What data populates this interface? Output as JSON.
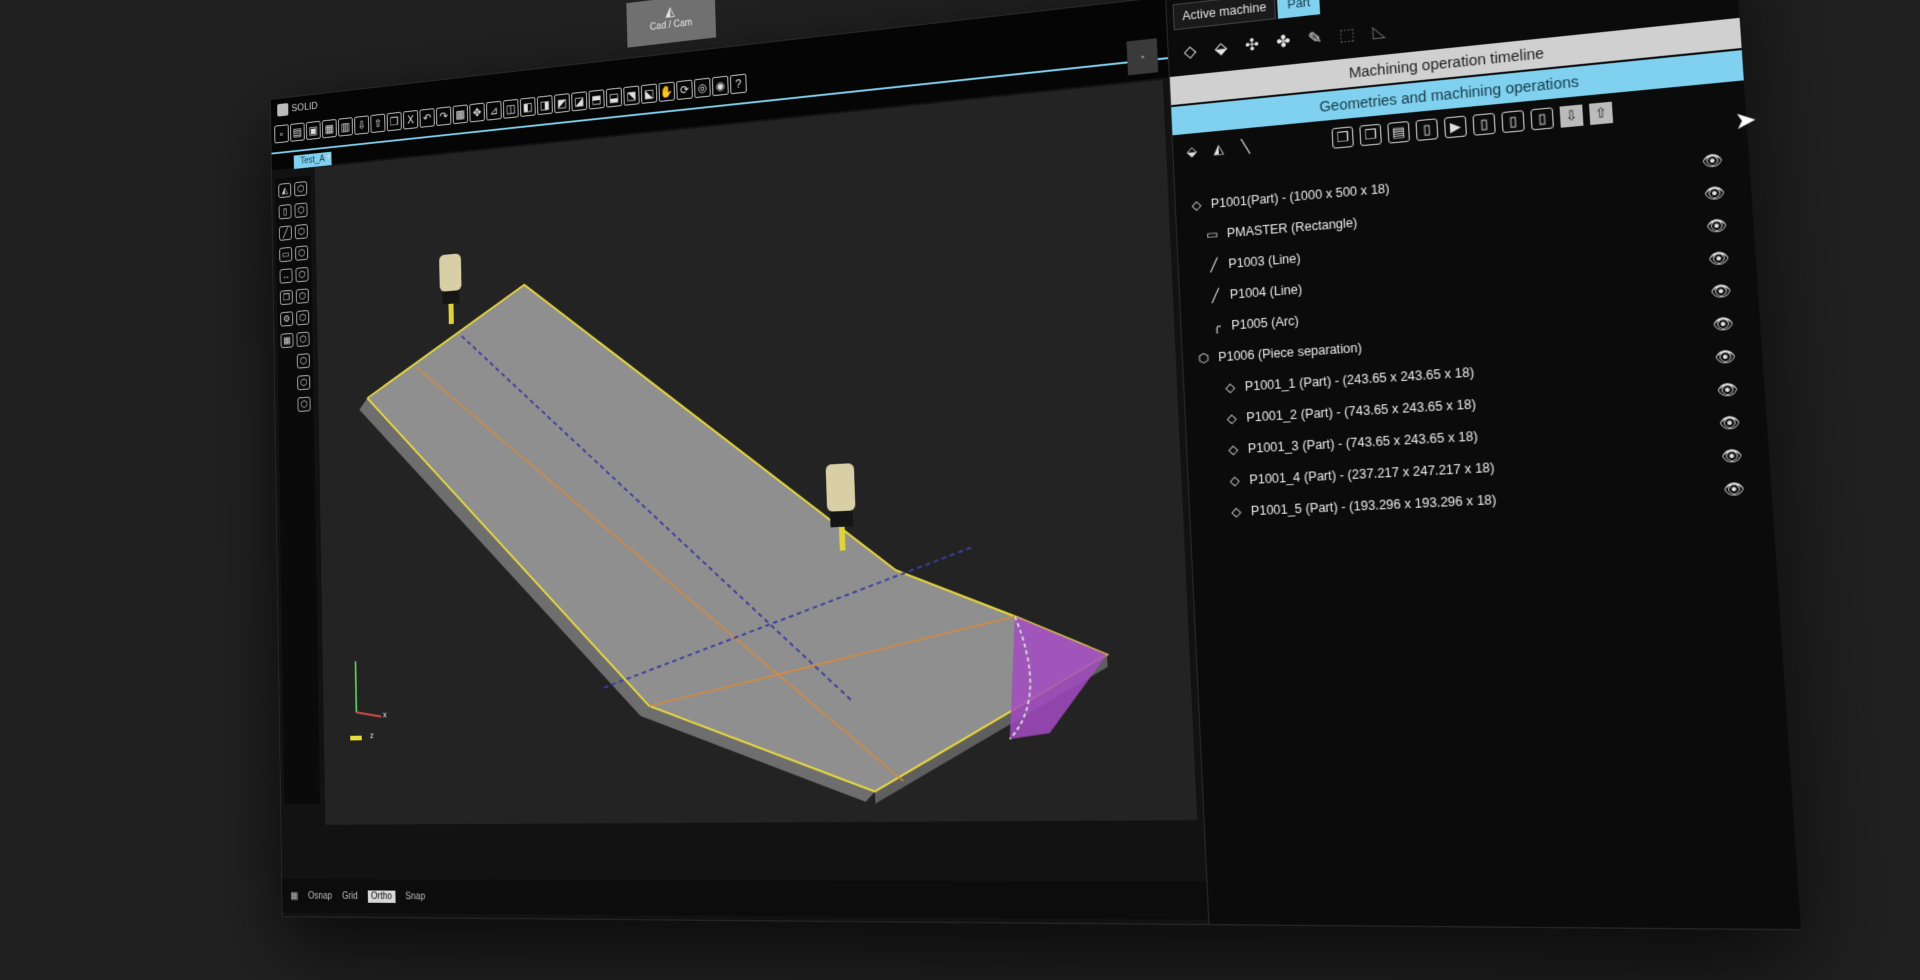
{
  "app": {
    "title": "SOLID",
    "mode_tab": "Cad / Cam"
  },
  "toolbar": {
    "icons": [
      "new-file-icon",
      "open-file-icon",
      "save-icon",
      "save-as-icon",
      "print-icon",
      "import-icon",
      "export-icon",
      "undo-icon",
      "redo-icon",
      "copy-icon",
      "delete-icon",
      "rotate-icon",
      "move-icon",
      "measure-icon",
      "lock-icon",
      "view-top-icon",
      "view-front-icon",
      "view-side-icon",
      "view-iso-icon",
      "view-back-icon",
      "view-bottom-icon",
      "view-left-icon",
      "view-right-icon",
      "wireframe-icon",
      "pan-icon",
      "orbit-icon",
      "zoom-fit-icon",
      "zoom-window-icon",
      "help-icon"
    ],
    "help_glyph": "?",
    "delete_glyph": "X"
  },
  "document_tab": {
    "label": "Test_A"
  },
  "status_bar": {
    "items": [
      "Osnap",
      "Grid",
      "Ortho",
      "Snap"
    ],
    "active": "Ortho"
  },
  "viewport": {
    "axis_label_z": "z",
    "axis_label_x": "x",
    "part_colors": {
      "top": "#8f8f8f",
      "side": "#6e6e6e",
      "outline": "#e9d93c",
      "dashed": "#3d3f9e",
      "cut": "#a24bc2",
      "orange": "#d98a3c"
    }
  },
  "panel": {
    "tabs": [
      "Active machine",
      "Part"
    ],
    "active_tab": "Part",
    "sections": {
      "timeline": "Machining operation timeline",
      "geometries": "Geometries and machining operations"
    },
    "tree": [
      {
        "label": "P1001(Part) - (1000 x 500 x 18)",
        "icon": "part-diamond-icon",
        "glyph": "◇",
        "level": 0
      },
      {
        "label": "PMASTER (Rectangle)",
        "icon": "rectangle-icon",
        "glyph": "▭",
        "level": 1
      },
      {
        "label": "P1003 (Line)",
        "icon": "line-icon",
        "glyph": "╱",
        "level": 1
      },
      {
        "label": "P1004 (Line)",
        "icon": "line-icon",
        "glyph": "╱",
        "level": 1
      },
      {
        "label": "P1005 (Arc)",
        "icon": "arc-icon",
        "glyph": "╭",
        "level": 1
      },
      {
        "label": "P1006 (Piece separation)",
        "icon": "piece-separation-icon",
        "glyph": "⬡",
        "level": 0
      },
      {
        "label": "P1001_1 (Part) - (243.65 x 243.65 x 18)",
        "icon": "part-diamond-icon",
        "glyph": "◇",
        "level": 2
      },
      {
        "label": "P1001_2 (Part) - (743.65 x 243.65 x 18)",
        "icon": "part-diamond-icon",
        "glyph": "◇",
        "level": 2
      },
      {
        "label": "P1001_3 (Part) - (743.65 x 243.65 x 18)",
        "icon": "part-diamond-icon",
        "glyph": "◇",
        "level": 2
      },
      {
        "label": "P1001_4 (Part) - (237.217 x 247.217 x 18)",
        "icon": "part-diamond-icon",
        "glyph": "◇",
        "level": 2
      },
      {
        "label": "P1001_5 (Part) - (193.296 x 193.296 x 18)",
        "icon": "part-diamond-icon",
        "glyph": "◇",
        "level": 2
      }
    ],
    "eye_glyph": "👁"
  },
  "colors": {
    "accent": "#7fd1ef",
    "background": "#121212",
    "panel": "#0b0b0b"
  }
}
